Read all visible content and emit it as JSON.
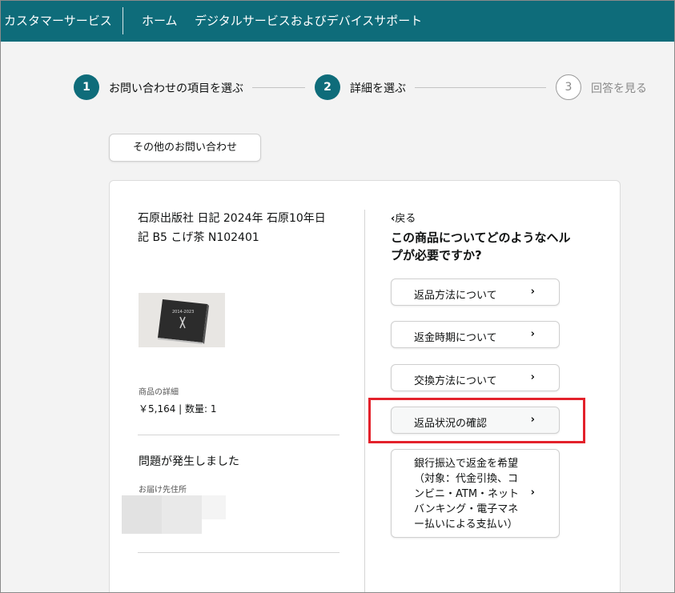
{
  "header": {
    "brand": "カスタマーサービス",
    "nav": [
      "ホーム",
      "デジタルサービスおよびデバイスサポート"
    ]
  },
  "stepper": [
    {
      "number": "1",
      "label": "お問い合わせの項目を選ぶ",
      "state": "done"
    },
    {
      "number": "2",
      "label": "詳細を選ぶ",
      "state": "current"
    },
    {
      "number": "3",
      "label": "回答を見る",
      "state": "upcoming"
    }
  ],
  "other_inquiry_label": "その他のお問い合わせ",
  "product": {
    "title_line1": "石原出版社 日記 2024年 石原10年日",
    "title_line2": "記 B5 こげ茶 N102401",
    "image_text": "2014-2023",
    "detail_label": "商品の詳細",
    "detail_value": "￥5,164 | 数量: 1"
  },
  "problem_text": "問題が発生しました",
  "address_label": "お届け先住所",
  "help": {
    "back_label": "戻る",
    "question_line1": "この商品についてどのようなヘル",
    "question_line2": "プが必要ですか?",
    "options": [
      {
        "label": "返品方法について"
      },
      {
        "label": "返金時期について"
      },
      {
        "label": "交換方法について"
      },
      {
        "label": "返品状況の確認",
        "highlighted": true
      },
      {
        "label_lines": [
          "銀行振込で返金を希望",
          "（対象：代金引換、コ",
          "ンビニ・ATM・ネット",
          "バンキング・電子マネ",
          "ー払いによる支払い）"
        ]
      }
    ]
  },
  "colors": {
    "brand": "#0e6c7a",
    "highlight": "#e3212b"
  },
  "icons": {
    "chevron": "›",
    "back": "‹"
  }
}
